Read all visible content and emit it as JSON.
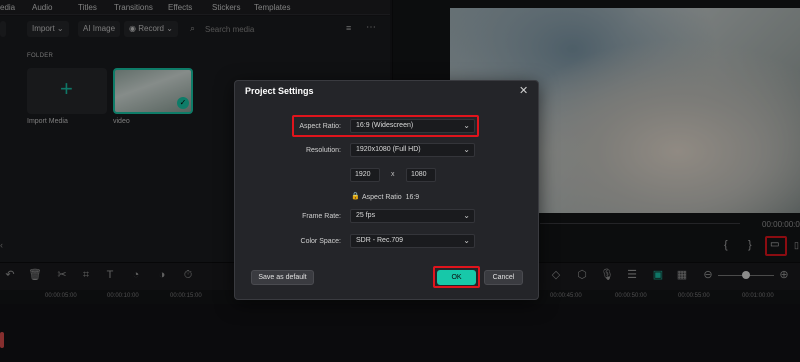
{
  "tabs": [
    "edia",
    "Audio",
    "Titles",
    "Transitions",
    "Effects",
    "Stickers",
    "Templates"
  ],
  "media_toolbar": {
    "import_label": "Import",
    "ai_image_label": "AI Image",
    "record_label": "Record",
    "search_placeholder": "Search media"
  },
  "media": {
    "folder_label": "FOLDER",
    "import_label": "Import Media",
    "video_label": "video"
  },
  "preview": {
    "timecode": "00:00:00:00"
  },
  "ruler": [
    "00:00:05:00",
    "00:00:10:00",
    "00:00:15:00",
    "00:00:45:00",
    "00:00:50:00",
    "00:00:55:00",
    "00:01:00:00"
  ],
  "dialog": {
    "title": "Project Settings",
    "aspect_label": "Aspect Ratio:",
    "aspect_value": "16:9 (Widescreen)",
    "resolution_label": "Resolution:",
    "resolution_value": "1920x1080 (Full HD)",
    "width": "1920",
    "x_sep": "x",
    "height": "1080",
    "lock_text": "Aspect Ratio",
    "lock_ratio": "16:9",
    "framerate_label": "Frame Rate:",
    "framerate_value": "25 fps",
    "colorspace_label": "Color Space:",
    "colorspace_value": "SDR - Rec.709",
    "save_default": "Save as default",
    "ok": "OK",
    "cancel": "Cancel"
  },
  "colors": {
    "accent": "#17c8a9",
    "highlight": "#e0141c"
  }
}
